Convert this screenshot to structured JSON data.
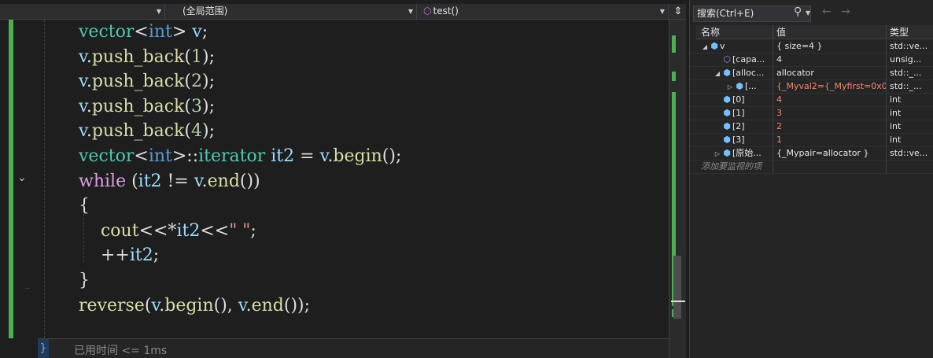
{
  "navbar": {
    "project": "",
    "scope": "(全局范围)",
    "member": "test()"
  },
  "code": {
    "lines": [
      [
        {
          "t": "vector",
          "c": "ty"
        },
        {
          "t": "<",
          "c": "pl"
        },
        {
          "t": "int",
          "c": "kw"
        },
        {
          "t": "> ",
          "c": "pl"
        },
        {
          "t": "v",
          "c": "var"
        },
        {
          "t": ";",
          "c": "pl"
        }
      ],
      [
        {
          "t": "v",
          "c": "var"
        },
        {
          "t": ".",
          "c": "pl"
        },
        {
          "t": "push_back",
          "c": "fn"
        },
        {
          "t": "(",
          "c": "pl"
        },
        {
          "t": "1",
          "c": "num"
        },
        {
          "t": ");",
          "c": "pl"
        }
      ],
      [
        {
          "t": "v",
          "c": "var"
        },
        {
          "t": ".",
          "c": "pl"
        },
        {
          "t": "push_back",
          "c": "fn"
        },
        {
          "t": "(",
          "c": "pl"
        },
        {
          "t": "2",
          "c": "num"
        },
        {
          "t": ");",
          "c": "pl"
        }
      ],
      [
        {
          "t": "v",
          "c": "var"
        },
        {
          "t": ".",
          "c": "pl"
        },
        {
          "t": "push_back",
          "c": "fn"
        },
        {
          "t": "(",
          "c": "pl"
        },
        {
          "t": "3",
          "c": "num"
        },
        {
          "t": ");",
          "c": "pl"
        }
      ],
      [
        {
          "t": "v",
          "c": "var"
        },
        {
          "t": ".",
          "c": "pl"
        },
        {
          "t": "push_back",
          "c": "fn"
        },
        {
          "t": "(",
          "c": "pl"
        },
        {
          "t": "4",
          "c": "num"
        },
        {
          "t": ");",
          "c": "pl"
        }
      ],
      [
        {
          "t": "vector",
          "c": "ty"
        },
        {
          "t": "<",
          "c": "pl"
        },
        {
          "t": "int",
          "c": "kw"
        },
        {
          "t": ">::",
          "c": "pl"
        },
        {
          "t": "iterator",
          "c": "ty"
        },
        {
          "t": " ",
          "c": "pl"
        },
        {
          "t": "it2",
          "c": "var"
        },
        {
          "t": " = ",
          "c": "pl"
        },
        {
          "t": "v",
          "c": "var"
        },
        {
          "t": ".",
          "c": "pl"
        },
        {
          "t": "begin",
          "c": "fn"
        },
        {
          "t": "();",
          "c": "pl"
        }
      ],
      [
        {
          "t": "while",
          "c": "ctl"
        },
        {
          "t": " (",
          "c": "pl"
        },
        {
          "t": "it2",
          "c": "var"
        },
        {
          "t": " != ",
          "c": "pl"
        },
        {
          "t": "v",
          "c": "var"
        },
        {
          "t": ".",
          "c": "pl"
        },
        {
          "t": "end",
          "c": "fn"
        },
        {
          "t": "())",
          "c": "pl"
        }
      ],
      [
        {
          "t": "{",
          "c": "pl"
        }
      ],
      [
        {
          "t": "    ",
          "c": "pl"
        },
        {
          "t": "cout",
          "c": "fn"
        },
        {
          "t": "<<*",
          "c": "pl"
        },
        {
          "t": "it2",
          "c": "var"
        },
        {
          "t": "<<",
          "c": "pl"
        },
        {
          "t": "\" \"",
          "c": "str"
        },
        {
          "t": ";",
          "c": "pl"
        }
      ],
      [
        {
          "t": "    ++",
          "c": "pl"
        },
        {
          "t": "it2",
          "c": "var"
        },
        {
          "t": ";",
          "c": "pl"
        }
      ],
      [
        {
          "t": "}",
          "c": "pl"
        }
      ],
      [
        {
          "t": "reverse",
          "c": "fn"
        },
        {
          "t": "(",
          "c": "pl"
        },
        {
          "t": "v",
          "c": "var"
        },
        {
          "t": ".",
          "c": "pl"
        },
        {
          "t": "begin",
          "c": "fn"
        },
        {
          "t": "(), ",
          "c": "pl"
        },
        {
          "t": "v",
          "c": "var"
        },
        {
          "t": ".",
          "c": "pl"
        },
        {
          "t": "end",
          "c": "fn"
        },
        {
          "t": "());",
          "c": "pl"
        }
      ]
    ]
  },
  "status": {
    "elapsed": "已用时间 <= 1ms"
  },
  "watch": {
    "search_placeholder": "搜索(Ctrl+E)",
    "columns": {
      "name": "名称",
      "value": "值",
      "type": "类型"
    },
    "rows": [
      {
        "indent": 0,
        "expander": "open",
        "icon": "object",
        "name": "v",
        "value": "{ size=4 }",
        "type": "std::ve...",
        "changed": false
      },
      {
        "indent": 1,
        "expander": "none",
        "icon": "field",
        "name": "[capa...",
        "value": "4",
        "type": "unsig...",
        "changed": false
      },
      {
        "indent": 1,
        "expander": "open",
        "icon": "object",
        "name": "[alloc...",
        "value": "allocator",
        "type": "std::_...",
        "changed": false
      },
      {
        "indent": 2,
        "expander": "closed",
        "icon": "object",
        "name": "[...",
        "value": "{_Myval2={_Myfirst=0x0...",
        "type": "std::_...",
        "changed": true
      },
      {
        "indent": 1,
        "expander": "none",
        "icon": "object",
        "name": "[0]",
        "value": "4",
        "type": "int",
        "changed": true
      },
      {
        "indent": 1,
        "expander": "none",
        "icon": "object",
        "name": "[1]",
        "value": "3",
        "type": "int",
        "changed": true
      },
      {
        "indent": 1,
        "expander": "none",
        "icon": "object",
        "name": "[2]",
        "value": "2",
        "type": "int",
        "changed": true
      },
      {
        "indent": 1,
        "expander": "none",
        "icon": "object",
        "name": "[3]",
        "value": "1",
        "type": "int",
        "changed": true
      },
      {
        "indent": 1,
        "expander": "closed",
        "icon": "object",
        "name": "[原始...",
        "value": "{_Mypair=allocator }",
        "type": "std::ve...",
        "changed": false
      }
    ],
    "add_watch": "添加要监视的项"
  }
}
